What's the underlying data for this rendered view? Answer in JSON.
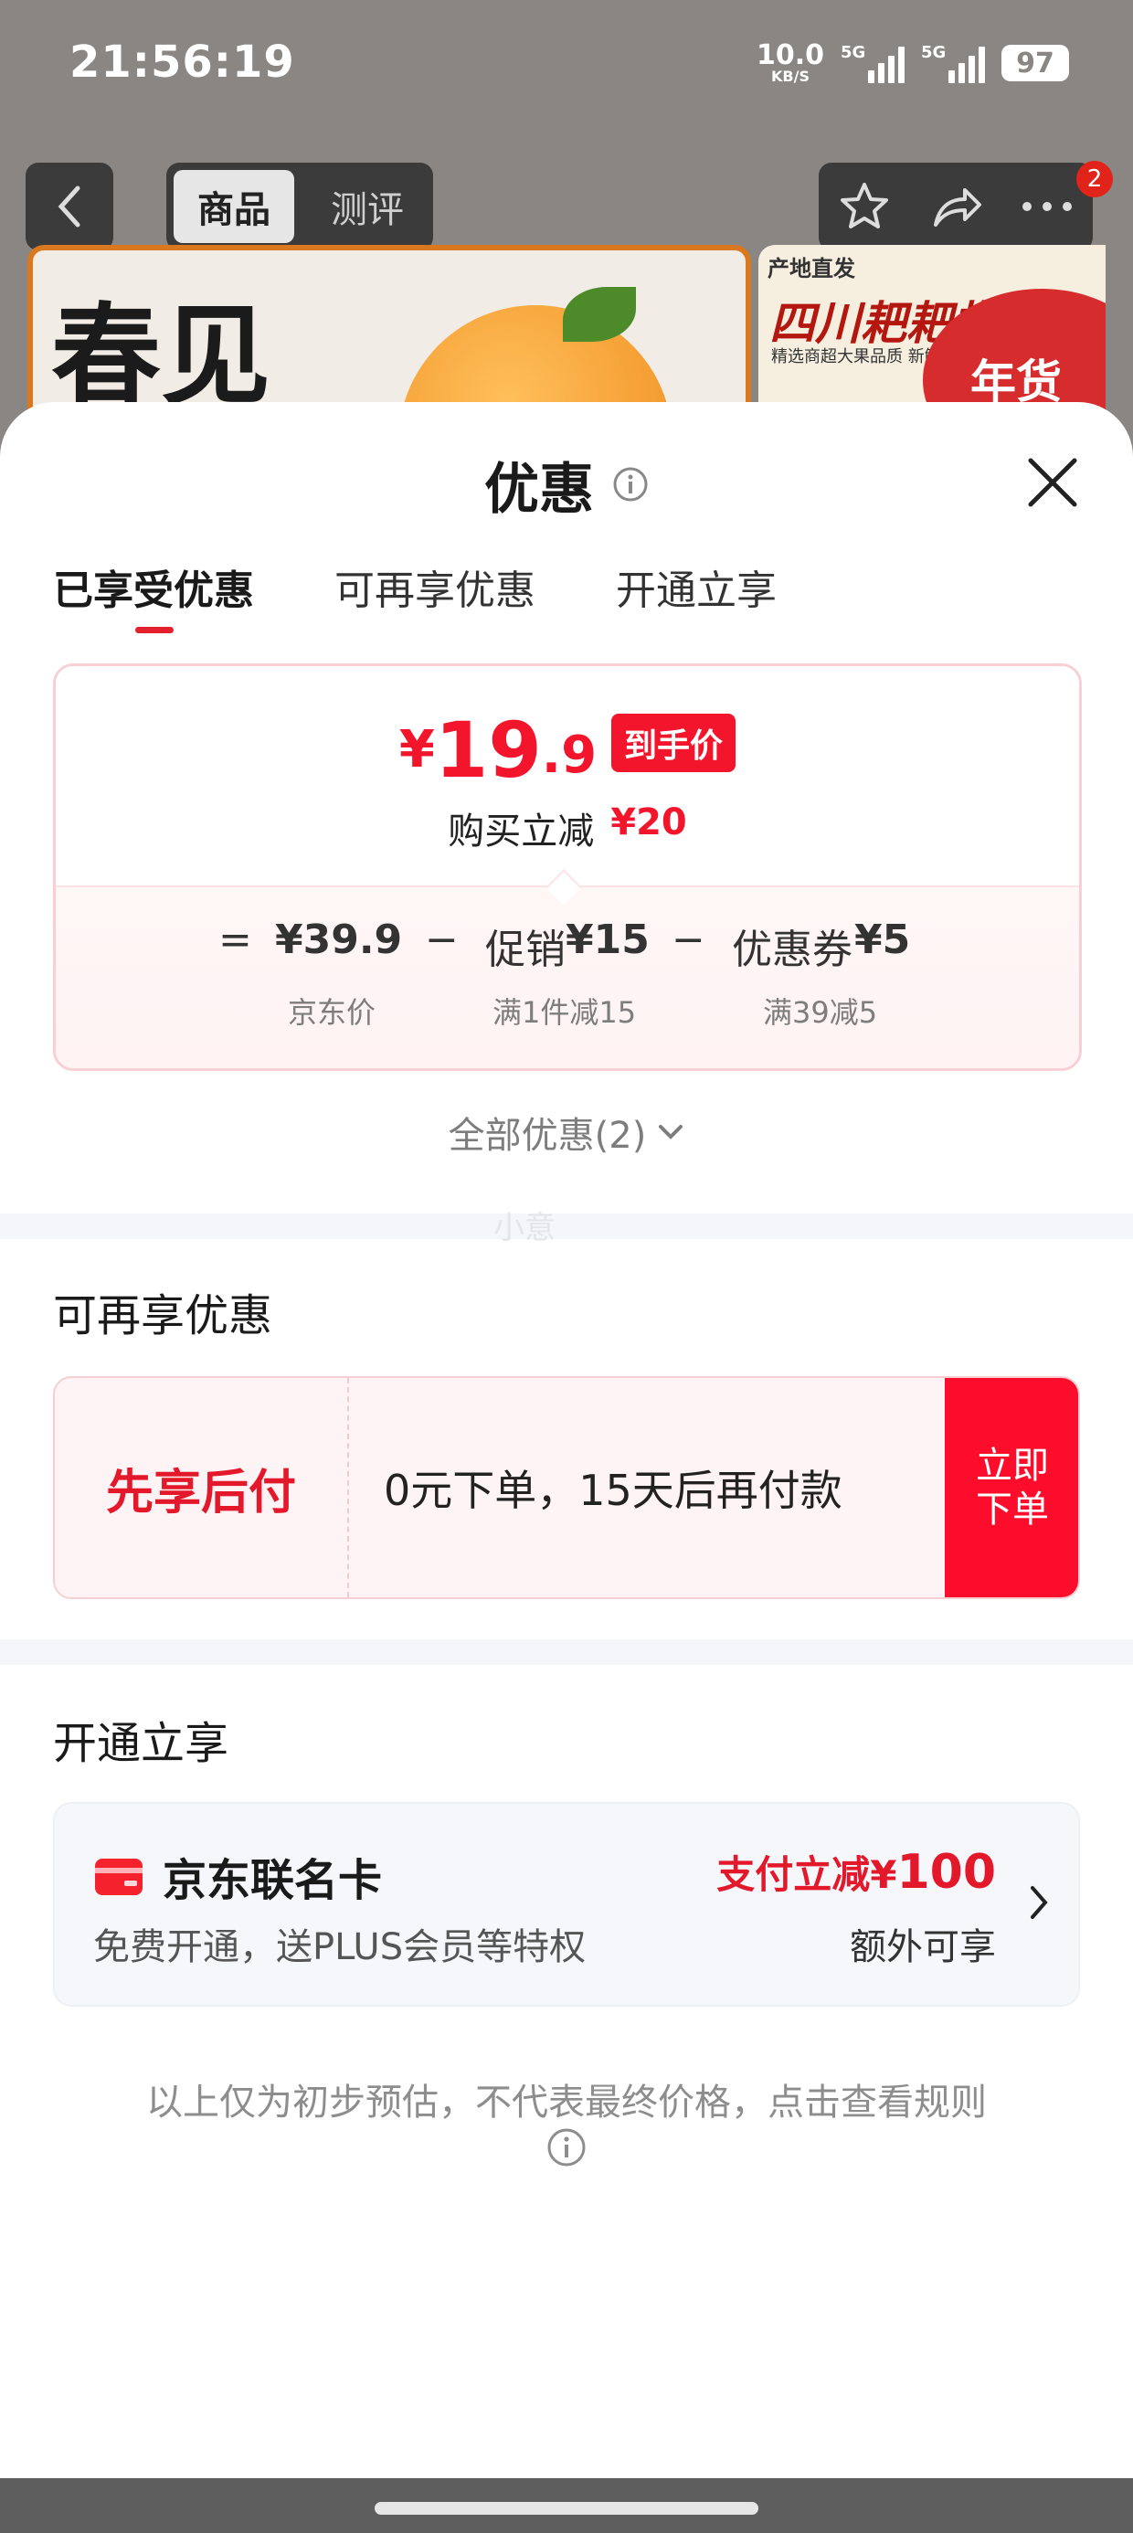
{
  "status_bar": {
    "time": "21:56:19",
    "net_speed": "10.0",
    "net_unit": "KB/S",
    "signal1": "5G",
    "signal2": "5G",
    "battery": "97"
  },
  "background": {
    "tab_product": "商品",
    "tab_review": "测评",
    "badge_count": "2",
    "banner_left_text": "春见",
    "banner_right_tag": "产地直发",
    "banner_right_title": "四川耙耙柑",
    "banner_right_sub": "精选商超大果品质 新鲜",
    "banner_right_seal": "年货节"
  },
  "sheet": {
    "title": "优惠",
    "tabs": [
      "已享受优惠",
      "可再享优惠",
      "开通立享"
    ]
  },
  "summary": {
    "currency": "¥",
    "price_int": "19",
    "price_dec": ".9",
    "price_tag": "到手价",
    "reduce_label": "购买立减",
    "reduce_amount": "¥20",
    "eq_sign": "=",
    "minus_sign": "−",
    "base_price": "¥39.9",
    "base_label": "京东价",
    "promo_label": "促销",
    "promo_amount": "¥15",
    "promo_rule": "满1件减15",
    "coupon_label": "优惠券",
    "coupon_amount": "¥5",
    "coupon_rule": "满39减5"
  },
  "all_discounts": "全部优惠(2)",
  "watermark": "小意",
  "more_section": {
    "title": "可再享优惠",
    "bnpl_name": "先享后付",
    "bnpl_desc": "0元下单，15天后再付款",
    "bnpl_btn": "立即下单"
  },
  "open_section": {
    "title": "开通立享",
    "card_name": "京东联名卡",
    "card_desc": "免费开通，送PLUS会员等特权",
    "promo_prefix": "支付立减¥",
    "promo_amount": "100",
    "extra": "额外可享"
  },
  "footnote": "以上仅为初步预估，不代表最终价格，点击查看规则",
  "colors": {
    "accent": "#f2152b",
    "button_red": "#fd0d2c"
  }
}
